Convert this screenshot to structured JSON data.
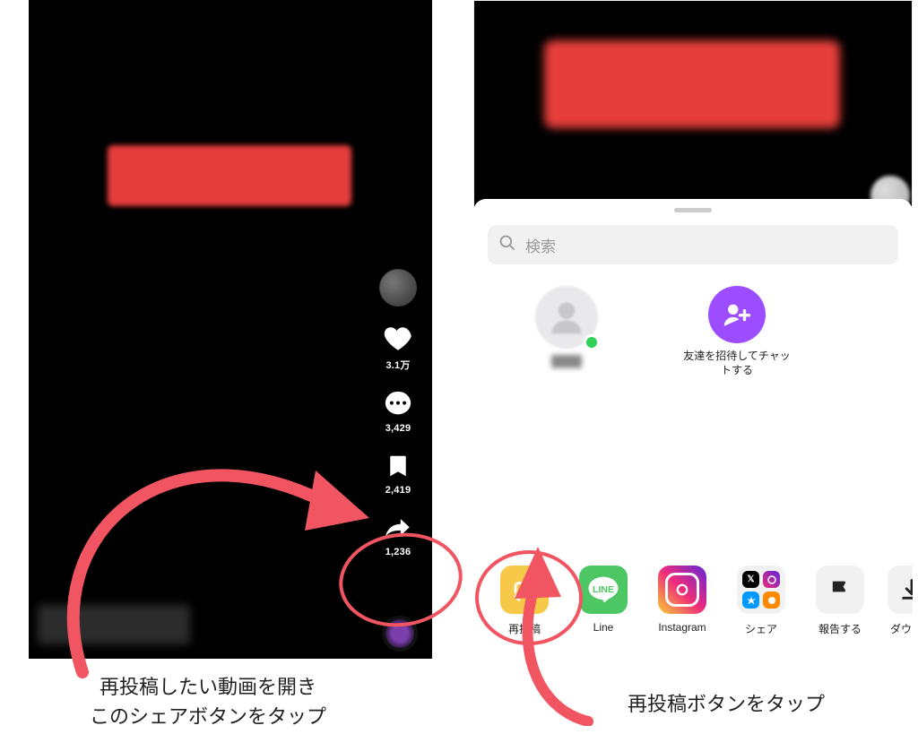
{
  "left": {
    "like_count": "3.1万",
    "comment_count": "3,429",
    "bookmark_count": "2,419",
    "share_count": "1,236"
  },
  "right": {
    "search_placeholder": "検索",
    "invite_label": "友達を招待してチャットする",
    "share_items": {
      "repost": "再投稿",
      "line": "Line",
      "instagram": "Instagram",
      "share": "シェア",
      "report": "報告する",
      "download": "ダウンロ"
    }
  },
  "annotations": {
    "caption1_line1": "再投稿したい動画を開き",
    "caption1_line2": "このシェアボタンをタップ",
    "caption2": "再投稿ボタンをタップ"
  }
}
